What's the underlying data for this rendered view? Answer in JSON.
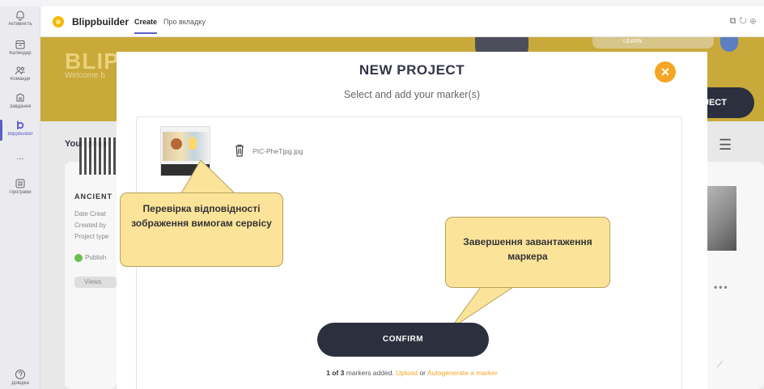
{
  "rail": {
    "items": [
      {
        "label": "Активність",
        "icon": "bell-icon"
      },
      {
        "label": "Календар",
        "icon": "calendar-icon"
      },
      {
        "label": "Команди",
        "icon": "teams-icon"
      },
      {
        "label": "Завдання",
        "icon": "assignments-icon"
      },
      {
        "label": "Blippbuilder",
        "icon": "blippbuilder-icon"
      },
      {
        "label": "...",
        "icon": "more-icon"
      },
      {
        "label": "Програми",
        "icon": "apps-icon"
      }
    ],
    "help_label": "Довідка"
  },
  "topbar": {
    "app_name": "Blippbuilder",
    "tabs": [
      "Create",
      "Про вкладку"
    ],
    "icons": [
      "popout-icon",
      "refresh-icon",
      "globe-icon"
    ]
  },
  "banner": {
    "title": "BLIPP",
    "subtitle": "Welcome b",
    "learn": "LEARN",
    "new_project_button": "PROJECT"
  },
  "content": {
    "projects_title": "Your proje",
    "card": {
      "title": "ANCIENT",
      "meta": [
        "Date Creat",
        "Created by",
        "Project type"
      ],
      "status": "Publish",
      "views": "Views"
    }
  },
  "modal": {
    "title": "NEW PROJECT",
    "subtitle": "Select and add your marker(s)",
    "close": "×",
    "file_name": "PIC-PheTjpg.jpg",
    "confirm": "CONFIRM",
    "footer": {
      "count": "1 of 3",
      "text": " markers added. ",
      "upload": "Upload",
      "or": " or ",
      "autogen": "Autogenerate a marker"
    }
  },
  "callouts": {
    "callout1": "Перевірка відповідності зображення вимогам сервісу",
    "callout2": "Завершення завантаження маркера"
  },
  "colors": {
    "accent": "#f5a623",
    "dark": "#2c2f3e",
    "banner": "#c9a93a",
    "callout": "#fbe39a",
    "teams": "#5b5fc7"
  }
}
